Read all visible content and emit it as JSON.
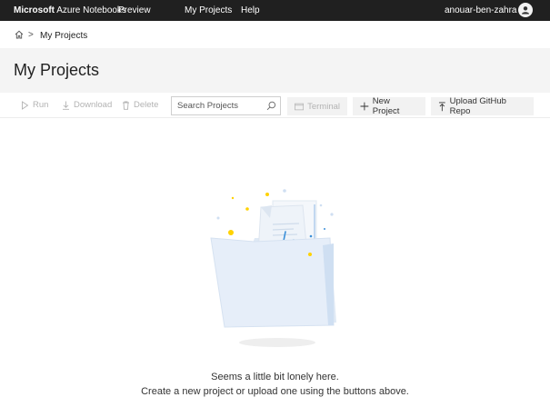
{
  "topbar": {
    "brand_bold": "Microsoft",
    "brand_rest": " Azure Notebooks",
    "preview_label": "Preview",
    "nav": [
      "My Projects",
      "Help"
    ],
    "username": "anouar-ben-zahra",
    "avatar_icon": "user-icon"
  },
  "breadcrumb": {
    "home_icon": "home-icon",
    "separator": ">",
    "current": "My Projects"
  },
  "page": {
    "title": "My Projects"
  },
  "toolbar": {
    "run_label": "Run",
    "download_label": "Download",
    "delete_label": "Delete",
    "search_placeholder": "Search Projects",
    "terminal_label": "Terminal",
    "new_project_label": "New Project",
    "upload_label": "Upload GitHub Repo"
  },
  "empty_state": {
    "line1": "Seems a little bit lonely here.",
    "line2": "Create a new project or upload one using the buttons above.",
    "illustration": "empty-folder-illustration"
  },
  "colors": {
    "topbar_bg": "#202020",
    "title_bg": "#f4f4f4",
    "button_bg": "#f2f2f2",
    "accent_blue": "#3a8fd8",
    "sparkle_yellow": "#ffd200"
  }
}
